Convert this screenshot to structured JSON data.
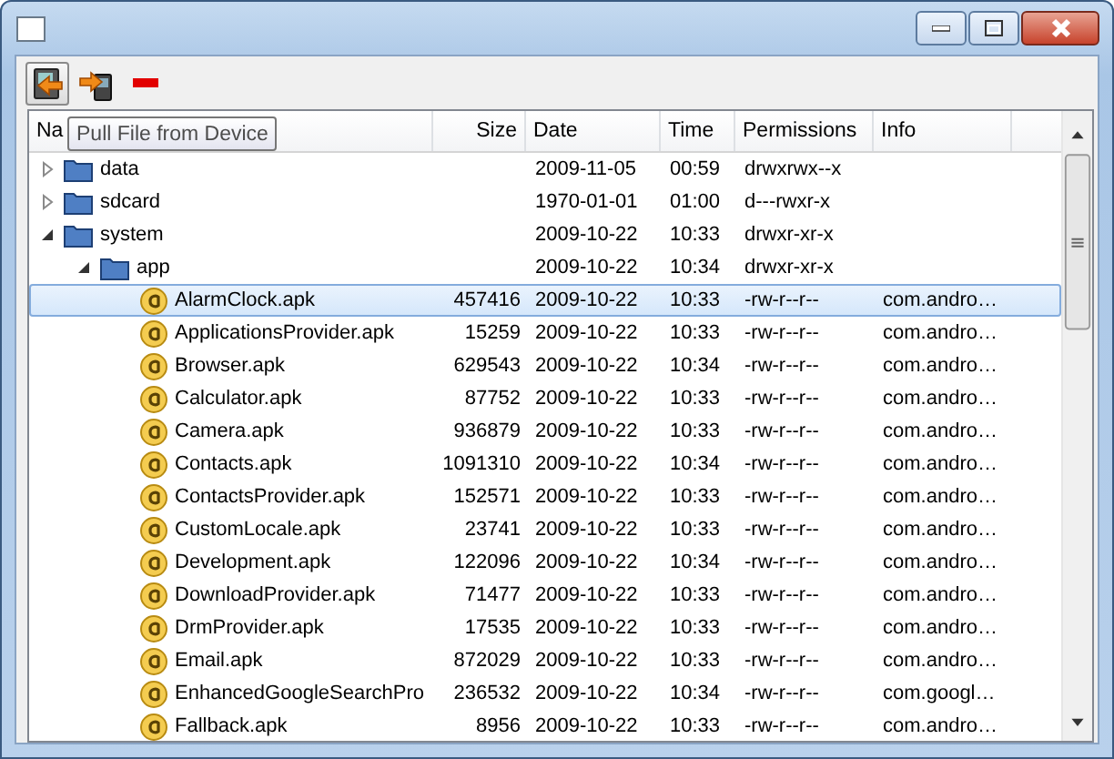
{
  "toolbar": [
    {
      "kind": "pull",
      "hovered": true
    },
    {
      "kind": "push",
      "hovered": false
    },
    {
      "kind": "delete",
      "hovered": false
    }
  ],
  "tooltip": "Pull File from Device",
  "table": {
    "columns": [
      "Na",
      "Size",
      "Date",
      "Time",
      "Permissions",
      "Info"
    ],
    "rows": [
      {
        "kind": "folder",
        "name": "data",
        "date": "2009-11-05",
        "time": "00:59",
        "permissions": "drwxrwx--x",
        "expanded": false,
        "selected": false
      },
      {
        "kind": "folder",
        "name": "sdcard",
        "date": "1970-01-01",
        "time": "01:00",
        "permissions": "d---rwxr-x",
        "expanded": false,
        "selected": false
      },
      {
        "kind": "folder",
        "name": "system",
        "date": "2009-10-22",
        "time": "10:33",
        "permissions": "drwxr-xr-x",
        "expanded": true,
        "selected": false,
        "children": [
          {
            "kind": "folder",
            "name": "app",
            "date": "2009-10-22",
            "time": "10:34",
            "permissions": "drwxr-xr-x",
            "expanded": true,
            "selected": false,
            "children": [
              {
                "kind": "apk",
                "name": "AlarmClock.apk",
                "size": "457416",
                "date": "2009-10-22",
                "time": "10:33",
                "permissions": "-rw-r--r--",
                "info": "com.andro…",
                "selected": true
              },
              {
                "kind": "apk",
                "name": "ApplicationsProvider.apk",
                "size": "15259",
                "date": "2009-10-22",
                "time": "10:33",
                "permissions": "-rw-r--r--",
                "info": "com.andro…",
                "selected": false
              },
              {
                "kind": "apk",
                "name": "Browser.apk",
                "size": "629543",
                "date": "2009-10-22",
                "time": "10:34",
                "permissions": "-rw-r--r--",
                "info": "com.andro…",
                "selected": false
              },
              {
                "kind": "apk",
                "name": "Calculator.apk",
                "size": "87752",
                "date": "2009-10-22",
                "time": "10:33",
                "permissions": "-rw-r--r--",
                "info": "com.andro…",
                "selected": false
              },
              {
                "kind": "apk",
                "name": "Camera.apk",
                "size": "936879",
                "date": "2009-10-22",
                "time": "10:33",
                "permissions": "-rw-r--r--",
                "info": "com.andro…",
                "selected": false
              },
              {
                "kind": "apk",
                "name": "Contacts.apk",
                "size": "1091310",
                "date": "2009-10-22",
                "time": "10:34",
                "permissions": "-rw-r--r--",
                "info": "com.andro…",
                "selected": false
              },
              {
                "kind": "apk",
                "name": "ContactsProvider.apk",
                "size": "152571",
                "date": "2009-10-22",
                "time": "10:33",
                "permissions": "-rw-r--r--",
                "info": "com.andro…",
                "selected": false
              },
              {
                "kind": "apk",
                "name": "CustomLocale.apk",
                "size": "23741",
                "date": "2009-10-22",
                "time": "10:33",
                "permissions": "-rw-r--r--",
                "info": "com.andro…",
                "selected": false
              },
              {
                "kind": "apk",
                "name": "Development.apk",
                "size": "122096",
                "date": "2009-10-22",
                "time": "10:34",
                "permissions": "-rw-r--r--",
                "info": "com.andro…",
                "selected": false
              },
              {
                "kind": "apk",
                "name": "DownloadProvider.apk",
                "size": "71477",
                "date": "2009-10-22",
                "time": "10:33",
                "permissions": "-rw-r--r--",
                "info": "com.andro…",
                "selected": false
              },
              {
                "kind": "apk",
                "name": "DrmProvider.apk",
                "size": "17535",
                "date": "2009-10-22",
                "time": "10:33",
                "permissions": "-rw-r--r--",
                "info": "com.andro…",
                "selected": false
              },
              {
                "kind": "apk",
                "name": "Email.apk",
                "size": "872029",
                "date": "2009-10-22",
                "time": "10:33",
                "permissions": "-rw-r--r--",
                "info": "com.andro…",
                "selected": false
              },
              {
                "kind": "apk",
                "name": "EnhancedGoogleSearchPro",
                "size": "236532",
                "date": "2009-10-22",
                "time": "10:34",
                "permissions": "-rw-r--r--",
                "info": "com.googl…",
                "selected": false
              },
              {
                "kind": "apk",
                "name": "Fallback.apk",
                "size": "8956",
                "date": "2009-10-22",
                "time": "10:33",
                "permissions": "-rw-r--r--",
                "info": "com.andro…",
                "selected": false
              }
            ]
          }
        ]
      }
    ]
  }
}
